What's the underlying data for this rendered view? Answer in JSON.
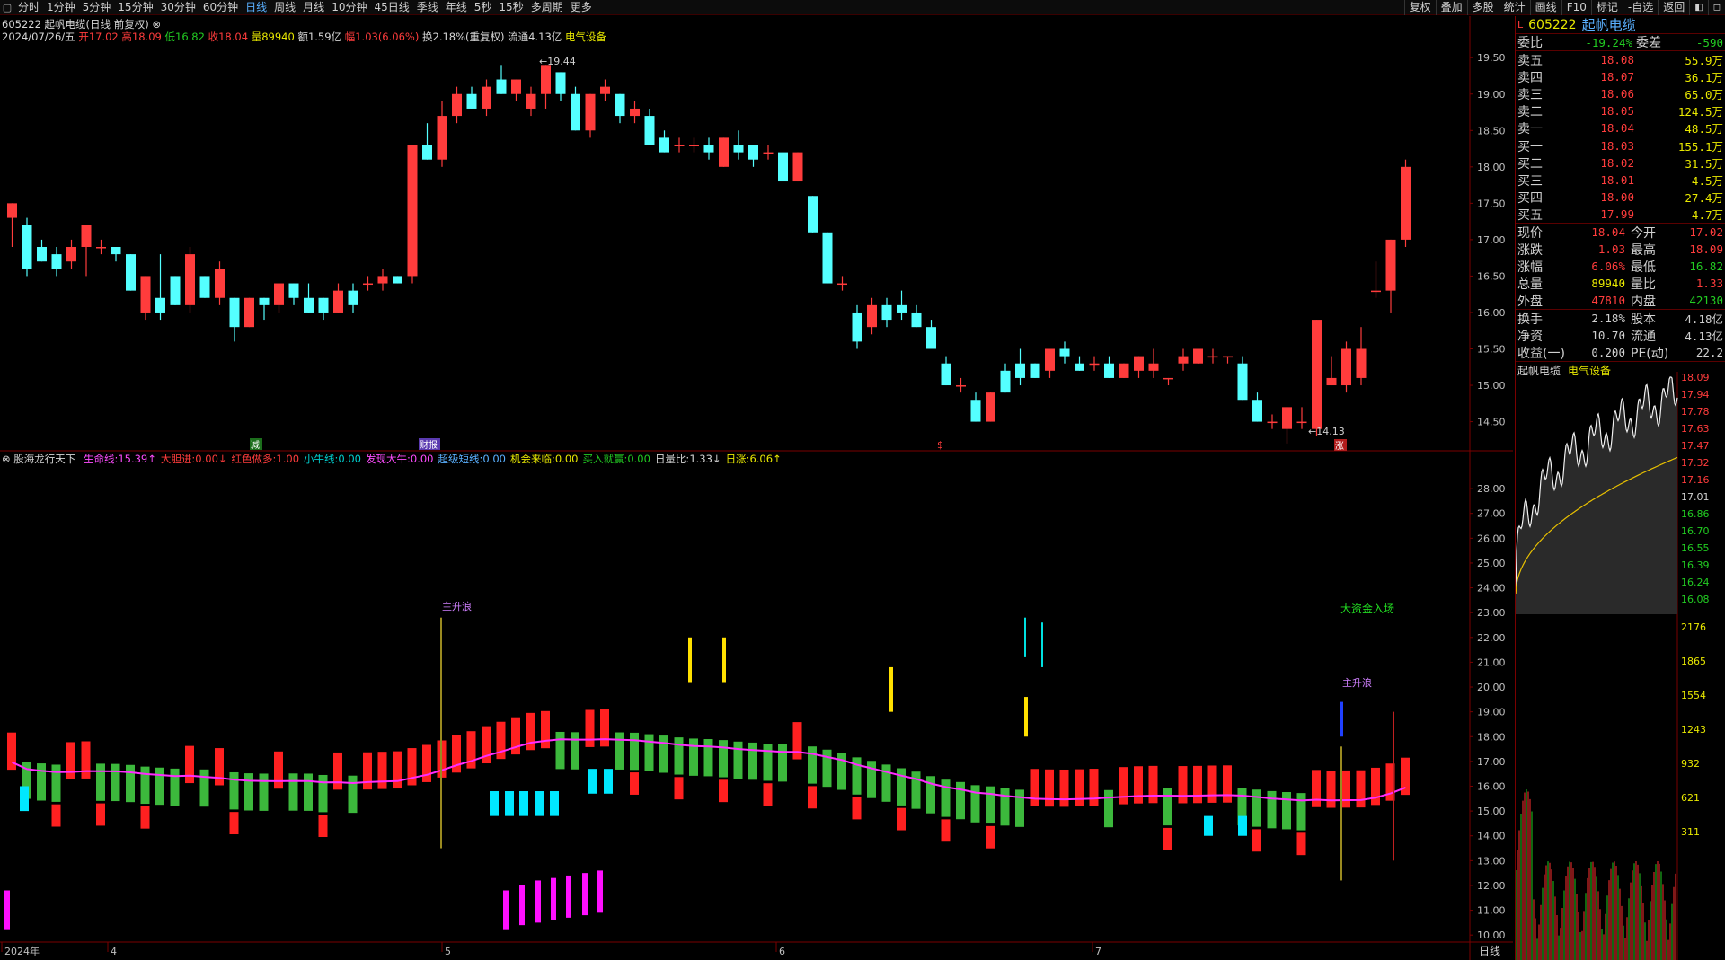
{
  "toolbar": {
    "periods": [
      "分时",
      "1分钟",
      "5分钟",
      "15分钟",
      "30分钟",
      "60分钟",
      "日线",
      "周线",
      "月线",
      "10分钟",
      "45日线",
      "季线",
      "年线",
      "5秒",
      "15秒",
      "多周期",
      "更多"
    ],
    "active_period": "日线",
    "right_buttons": [
      "复权",
      "叠加",
      "多股",
      "统计",
      "画线",
      "F10",
      "标记",
      "-自选",
      "返回"
    ]
  },
  "header": {
    "title": "605222 起帆电缆(日线 前复权)",
    "date": "2024/07/26/五",
    "open_label": "开",
    "open": "17.02",
    "high_label": "高",
    "high": "18.09",
    "low_label": "低",
    "low": "16.82",
    "close_label": "收",
    "close": "18.04",
    "vol_label": "量",
    "volume": "89940",
    "amount_label": "额",
    "amount": "1.59亿",
    "change_label": "幅",
    "change": "1.03(6.06%)",
    "turnover": "换2.18%(重复权)",
    "float": "流通4.13亿",
    "sector": "电气设备"
  },
  "indicator": {
    "name": "股海龙行天下",
    "items": [
      {
        "label": "生命线:",
        "value": "15.39",
        "arrow": "↑",
        "color": "#ff4cff"
      },
      {
        "label": "大胆进:",
        "value": "0.00",
        "arrow": "↓",
        "color": "#ff3c3c"
      },
      {
        "label": "红色做多:",
        "value": "1.00",
        "arrow": "",
        "color": "#ff3c3c"
      },
      {
        "label": "小牛线:",
        "value": "0.00",
        "arrow": "",
        "color": "#00d0d0"
      },
      {
        "label": "发现大牛:",
        "value": "0.00",
        "arrow": "",
        "color": "#ff4cff"
      },
      {
        "label": "超级短线:",
        "value": "0.00",
        "arrow": "",
        "color": "#5ab0ff"
      },
      {
        "label": "机会来临:",
        "value": "0.00",
        "arrow": "",
        "color": "#e8e800"
      },
      {
        "label": "买入就赢:",
        "value": "0.00",
        "arrow": "",
        "color": "#22cc22"
      },
      {
        "label": "日量比:",
        "value": "1.33",
        "arrow": "↓",
        "color": "#d6d6d6"
      },
      {
        "label": "日涨:",
        "value": "6.06",
        "arrow": "↑",
        "color": "#e8e800"
      }
    ]
  },
  "annotations": {
    "high_price": "19.44",
    "low_price": "14.13",
    "main_rise_1": "主升浪",
    "main_rise_2": "主升浪",
    "big_money": "大资金入场",
    "event_1": "减",
    "event_2": "财报",
    "event_3": "$",
    "event_4": "涨"
  },
  "chart_data": [
    {
      "type": "candlestick",
      "title": "605222 起帆电缆(日线 前复权)",
      "ylim": [
        14.1,
        19.7
      ],
      "y_ticks": [
        "19.50",
        "19.00",
        "18.50",
        "18.00",
        "17.50",
        "17.00",
        "16.50",
        "16.00",
        "15.50",
        "15.00",
        "14.50"
      ],
      "x_labels": [
        "2024年",
        "4",
        "5",
        "6",
        "7"
      ],
      "ohlc": [
        [
          17.3,
          17.5,
          16.9,
          17.5
        ],
        [
          17.2,
          17.3,
          16.5,
          16.6
        ],
        [
          16.9,
          17.0,
          16.7,
          16.7
        ],
        [
          16.8,
          16.9,
          16.5,
          16.6
        ],
        [
          16.7,
          17.0,
          16.6,
          16.9
        ],
        [
          16.9,
          17.2,
          16.5,
          17.2
        ],
        [
          16.9,
          17.0,
          16.8,
          16.9
        ],
        [
          16.9,
          16.9,
          16.7,
          16.8
        ],
        [
          16.8,
          16.8,
          16.3,
          16.3
        ],
        [
          16.0,
          16.5,
          15.9,
          16.5
        ],
        [
          16.2,
          16.8,
          15.9,
          16.0
        ],
        [
          16.5,
          16.5,
          16.1,
          16.1
        ],
        [
          16.1,
          16.9,
          16.0,
          16.8
        ],
        [
          16.5,
          16.5,
          16.2,
          16.2
        ],
        [
          16.2,
          16.7,
          16.1,
          16.6
        ],
        [
          16.2,
          16.2,
          15.6,
          15.8
        ],
        [
          15.8,
          16.2,
          15.8,
          16.2
        ],
        [
          16.2,
          16.2,
          15.9,
          16.1
        ],
        [
          16.1,
          16.4,
          16.0,
          16.4
        ],
        [
          16.4,
          16.4,
          16.1,
          16.2
        ],
        [
          16.2,
          16.4,
          16.0,
          16.0
        ],
        [
          16.2,
          16.2,
          15.9,
          16.0
        ],
        [
          16.0,
          16.4,
          16.0,
          16.3
        ],
        [
          16.3,
          16.4,
          16.0,
          16.1
        ],
        [
          16.4,
          16.5,
          16.3,
          16.4
        ],
        [
          16.4,
          16.6,
          16.3,
          16.5
        ],
        [
          16.5,
          16.5,
          16.4,
          16.4
        ],
        [
          16.5,
          18.3,
          16.4,
          18.3
        ],
        [
          18.3,
          18.6,
          18.1,
          18.1
        ],
        [
          18.1,
          18.9,
          18.0,
          18.7
        ],
        [
          18.7,
          19.1,
          18.6,
          19.0
        ],
        [
          19.0,
          19.1,
          18.8,
          18.8
        ],
        [
          18.8,
          19.2,
          18.7,
          19.1
        ],
        [
          19.2,
          19.4,
          19.0,
          19.0
        ],
        [
          19.0,
          19.2,
          18.9,
          19.2
        ],
        [
          18.8,
          19.1,
          18.7,
          19.0
        ],
        [
          19.0,
          19.4,
          18.8,
          19.4
        ],
        [
          19.3,
          19.3,
          18.9,
          19.0
        ],
        [
          19.0,
          19.1,
          18.5,
          18.5
        ],
        [
          18.5,
          19.0,
          18.4,
          19.0
        ],
        [
          19.0,
          19.2,
          18.9,
          19.1
        ],
        [
          19.0,
          19.0,
          18.6,
          18.7
        ],
        [
          18.7,
          18.9,
          18.6,
          18.8
        ],
        [
          18.7,
          18.8,
          18.3,
          18.3
        ],
        [
          18.4,
          18.5,
          18.2,
          18.2
        ],
        [
          18.3,
          18.4,
          18.2,
          18.3
        ],
        [
          18.3,
          18.4,
          18.2,
          18.3
        ],
        [
          18.3,
          18.4,
          18.1,
          18.2
        ],
        [
          18.0,
          18.4,
          18.0,
          18.4
        ],
        [
          18.3,
          18.5,
          18.1,
          18.2
        ],
        [
          18.3,
          18.3,
          18.0,
          18.1
        ],
        [
          18.2,
          18.3,
          18.1,
          18.2
        ],
        [
          18.2,
          18.2,
          17.8,
          17.8
        ],
        [
          17.8,
          18.2,
          17.8,
          18.2
        ],
        [
          17.6,
          17.6,
          17.1,
          17.1
        ],
        [
          17.1,
          17.1,
          16.4,
          16.4
        ],
        [
          16.4,
          16.5,
          16.3,
          16.4
        ],
        [
          16.0,
          16.1,
          15.5,
          15.6
        ],
        [
          15.8,
          16.2,
          15.7,
          16.1
        ],
        [
          16.1,
          16.2,
          15.8,
          15.9
        ],
        [
          16.1,
          16.3,
          15.9,
          16.0
        ],
        [
          16.0,
          16.1,
          15.8,
          15.8
        ],
        [
          15.8,
          15.9,
          15.5,
          15.5
        ],
        [
          15.3,
          15.4,
          15.0,
          15.0
        ],
        [
          15.0,
          15.1,
          14.9,
          15.0
        ],
        [
          14.8,
          14.9,
          14.5,
          14.5
        ],
        [
          14.5,
          14.9,
          14.5,
          14.9
        ],
        [
          15.2,
          15.3,
          14.9,
          14.9
        ],
        [
          15.3,
          15.5,
          15.0,
          15.1
        ],
        [
          15.3,
          15.3,
          15.1,
          15.1
        ],
        [
          15.2,
          15.5,
          15.1,
          15.5
        ],
        [
          15.5,
          15.6,
          15.3,
          15.4
        ],
        [
          15.3,
          15.4,
          15.2,
          15.2
        ],
        [
          15.3,
          15.4,
          15.2,
          15.3
        ],
        [
          15.3,
          15.4,
          15.1,
          15.1
        ],
        [
          15.1,
          15.3,
          15.1,
          15.3
        ],
        [
          15.2,
          15.4,
          15.1,
          15.4
        ],
        [
          15.2,
          15.5,
          15.1,
          15.3
        ],
        [
          15.1,
          15.1,
          15.0,
          15.1
        ],
        [
          15.3,
          15.5,
          15.2,
          15.4
        ],
        [
          15.3,
          15.5,
          15.3,
          15.5
        ],
        [
          15.4,
          15.5,
          15.3,
          15.4
        ],
        [
          15.4,
          15.4,
          15.3,
          15.4
        ],
        [
          15.3,
          15.4,
          14.8,
          14.8
        ],
        [
          14.8,
          14.9,
          14.5,
          14.5
        ],
        [
          14.5,
          14.6,
          14.4,
          14.5
        ],
        [
          14.4,
          14.7,
          14.2,
          14.7
        ],
        [
          14.5,
          14.7,
          14.4,
          14.5
        ],
        [
          14.4,
          15.9,
          14.3,
          15.9
        ],
        [
          15.0,
          15.4,
          15.0,
          15.1
        ],
        [
          15.0,
          15.6,
          14.9,
          15.5
        ],
        [
          15.1,
          15.8,
          15.0,
          15.5
        ],
        [
          16.3,
          16.7,
          16.2,
          16.3
        ],
        [
          16.3,
          17.0,
          16.0,
          17.0
        ],
        [
          17.0,
          18.1,
          16.9,
          18.0
        ]
      ]
    },
    {
      "type": "indicator-bars",
      "title": "股海龙行天下",
      "ylim": [
        9.5,
        28.8
      ],
      "y_ticks": [
        "28.00",
        "27.00",
        "26.00",
        "25.00",
        "24.00",
        "23.00",
        "22.00",
        "21.00",
        "20.00",
        "19.00",
        "18.00",
        "17.00",
        "16.00",
        "15.00",
        "14.00",
        "13.00",
        "12.00",
        "11.00",
        "10.00"
      ],
      "lifeline_last": 15.39
    },
    {
      "type": "intraday-line",
      "title": "起帆电缆",
      "ylim": [
        16.82,
        18.09
      ],
      "y_ticks": [
        "18.09",
        "17.94",
        "17.78",
        "17.63",
        "17.47",
        "17.32",
        "17.16",
        "17.01",
        "16.86",
        "16.70",
        "16.55",
        "16.39",
        "16.24",
        "16.08"
      ],
      "volume_ticks": [
        "2176",
        "1865",
        "1554",
        "1243",
        "932",
        "621",
        "311"
      ]
    }
  ],
  "panel": {
    "code": "605222",
    "name": "起帆电缆",
    "wb_label": "委比",
    "wb_value": "-19.24%",
    "wc_label": "委差",
    "wc_value": "-590",
    "asks": [
      {
        "label": "卖五",
        "price": "18.08",
        "vol": "55.9万"
      },
      {
        "label": "卖四",
        "price": "18.07",
        "vol": "36.1万"
      },
      {
        "label": "卖三",
        "price": "18.06",
        "vol": "65.0万"
      },
      {
        "label": "卖二",
        "price": "18.05",
        "vol": "124.5万"
      },
      {
        "label": "卖一",
        "price": "18.04",
        "vol": "48.5万"
      }
    ],
    "bids": [
      {
        "label": "买一",
        "price": "18.03",
        "vol": "155.1万"
      },
      {
        "label": "买二",
        "price": "18.02",
        "vol": "31.5万"
      },
      {
        "label": "买三",
        "price": "18.01",
        "vol": "4.5万"
      },
      {
        "label": "买四",
        "price": "18.00",
        "vol": "27.4万"
      },
      {
        "label": "买五",
        "price": "17.99",
        "vol": "4.7万"
      }
    ],
    "stats": [
      {
        "l1": "现价",
        "v1": "18.04",
        "l2": "今开",
        "v2": "17.02",
        "c1": "#ff3c3c",
        "c2": "#ff3c3c"
      },
      {
        "l1": "涨跌",
        "v1": "1.03",
        "l2": "最高",
        "v2": "18.09",
        "c1": "#ff3c3c",
        "c2": "#ff3c3c"
      },
      {
        "l1": "涨幅",
        "v1": "6.06%",
        "l2": "最低",
        "v2": "16.82",
        "c1": "#ff3c3c",
        "c2": "#22cc22"
      },
      {
        "l1": "总量",
        "v1": "89940",
        "l2": "量比",
        "v2": "1.33",
        "c1": "#e8e800",
        "c2": "#ff3c3c"
      },
      {
        "l1": "外盘",
        "v1": "47810",
        "l2": "内盘",
        "v2": "42130",
        "c1": "#ff3c3c",
        "c2": "#22cc22"
      }
    ],
    "stats2": [
      {
        "l1": "换手",
        "v1": "2.18%",
        "l2": "股本",
        "v2": "4.18亿"
      },
      {
        "l1": "净资",
        "v1": "10.70",
        "l2": "流通",
        "v2": "4.13亿"
      },
      {
        "l1": "收益(一)",
        "v1": "0.200",
        "l2": "PE(动)",
        "v2": "22.2"
      }
    ],
    "mini_title": "起帆电缆",
    "mini_sector": "电气设备",
    "footer": "日线"
  },
  "colors": {
    "up": "#ff3c3c",
    "down": "#54ffff",
    "lifeline": "#ff2cff",
    "green_bar": "#3cb83c",
    "grid": "#4a0000"
  }
}
